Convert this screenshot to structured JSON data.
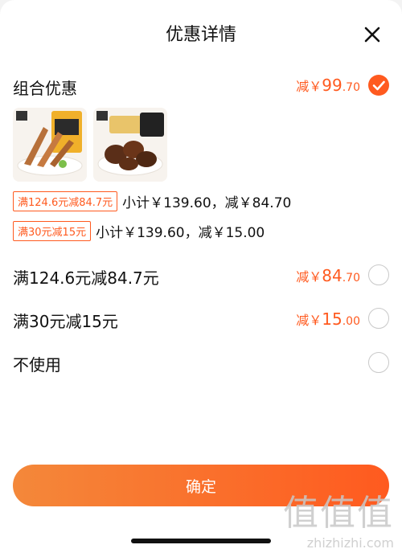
{
  "header": {
    "title": "优惠详情"
  },
  "combo": {
    "title": "组合优惠",
    "amount_prefix": "减￥",
    "amount_int": "99",
    "amount_dec": ".70",
    "selected": true,
    "lines": [
      {
        "tag": "满124.6元减84.7元",
        "text": "小计￥139.60，减￥84.70"
      },
      {
        "tag": "满30元减15元",
        "text": "小计￥139.60，减￥15.00"
      }
    ]
  },
  "options": [
    {
      "label": "满124.6元减84.7元",
      "amount_prefix": "减￥",
      "amount_int": "84",
      "amount_dec": ".70",
      "selected": false
    },
    {
      "label": "满30元减15元",
      "amount_prefix": "减￥",
      "amount_int": "15",
      "amount_dec": ".00",
      "selected": false
    },
    {
      "label": "不使用",
      "selected": false
    }
  ],
  "footer": {
    "confirm_label": "确定"
  },
  "watermark": {
    "glyphs": "值值值",
    "url": "zhizhizhi.com"
  },
  "colors": {
    "accent": "#ff5a1f",
    "text": "#111111"
  }
}
